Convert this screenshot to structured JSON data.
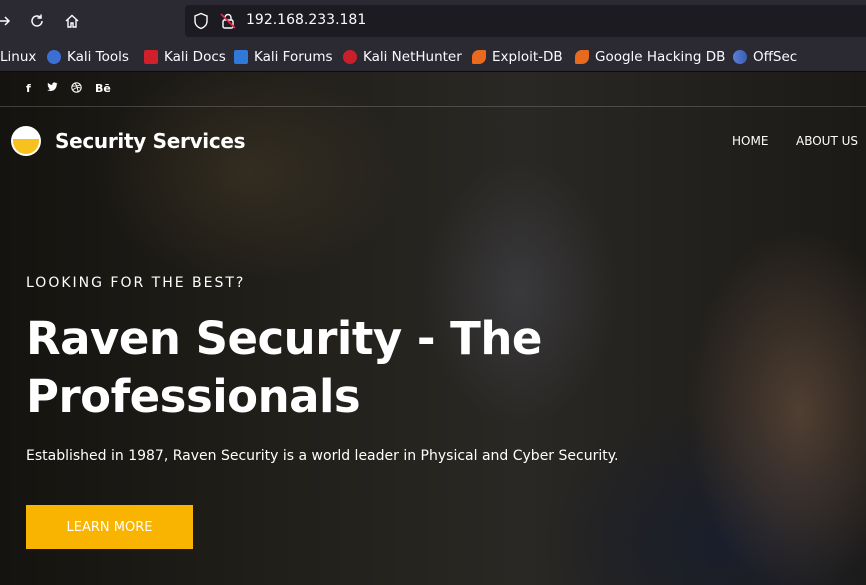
{
  "browser": {
    "url": "192.168.233.181"
  },
  "bookmarks": [
    {
      "label": "Linux",
      "icon": "none"
    },
    {
      "label": "Kali Tools",
      "icon": "kali-tools-icon",
      "color": "#3b6fd4"
    },
    {
      "label": "Kali Docs",
      "icon": "kali-docs-icon",
      "color": "#d0202b"
    },
    {
      "label": "Kali Forums",
      "icon": "kali-forums-icon",
      "color": "#2f7ad8"
    },
    {
      "label": "Kali NetHunter",
      "icon": "kali-nethunter-icon",
      "color": "#c8202b"
    },
    {
      "label": "Exploit-DB",
      "icon": "exploit-db-icon",
      "color": "#e86a1e"
    },
    {
      "label": "Google Hacking DB",
      "icon": "ghdb-icon",
      "color": "#e86a1e"
    },
    {
      "label": "OffSec",
      "icon": "offsec-icon",
      "color": "#5a7fd8"
    }
  ],
  "social": [
    "f",
    "t",
    "d",
    "Bē"
  ],
  "site": {
    "brand": "Security Services",
    "menu": [
      "HOME",
      "ABOUT US"
    ],
    "eyebrow": "LOOKING FOR THE BEST?",
    "headline_line1": "Raven Security - The",
    "headline_line2": "Professionals",
    "subtext": "Established in 1987, Raven Security is a world leader in Physical and Cyber Security.",
    "cta": "LEARN MORE",
    "accent": "#f8b400"
  }
}
